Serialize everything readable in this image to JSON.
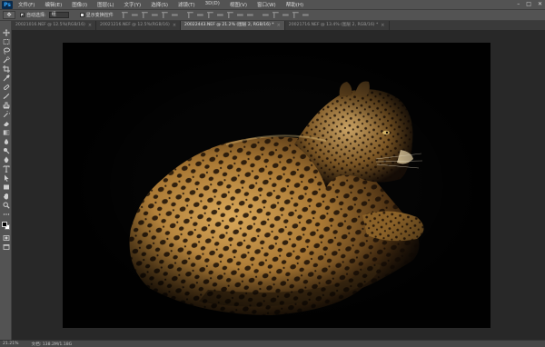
{
  "app": {
    "logo": "Ps"
  },
  "menu": [
    "文件(F)",
    "编辑(E)",
    "图像(I)",
    "图层(L)",
    "文字(Y)",
    "选择(S)",
    "滤镜(T)",
    "3D(D)",
    "视图(V)",
    "窗口(W)",
    "帮助(H)"
  ],
  "window_controls": [
    "–",
    "□",
    "✕"
  ],
  "options": {
    "auto_select_label": "自动选择:",
    "auto_select_value": "组",
    "show_transform_label": "显示变换控件"
  },
  "tabs": [
    {
      "label": "20021016.NEF @ 12.5%(RGB/16)",
      "active": false
    },
    {
      "label": "20021216.NEF @ 12.5%(RGB/16)",
      "active": false
    },
    {
      "label": "20022443.NEF @ 21.2% (图层 2, RGB/16) *",
      "active": true
    },
    {
      "label": "20021716.NEF @ 13.4% (图层 2, RGB/16) *",
      "active": false
    }
  ],
  "status": {
    "zoom": "21.21%",
    "doc": "文档: 138.2M/1.18G"
  }
}
